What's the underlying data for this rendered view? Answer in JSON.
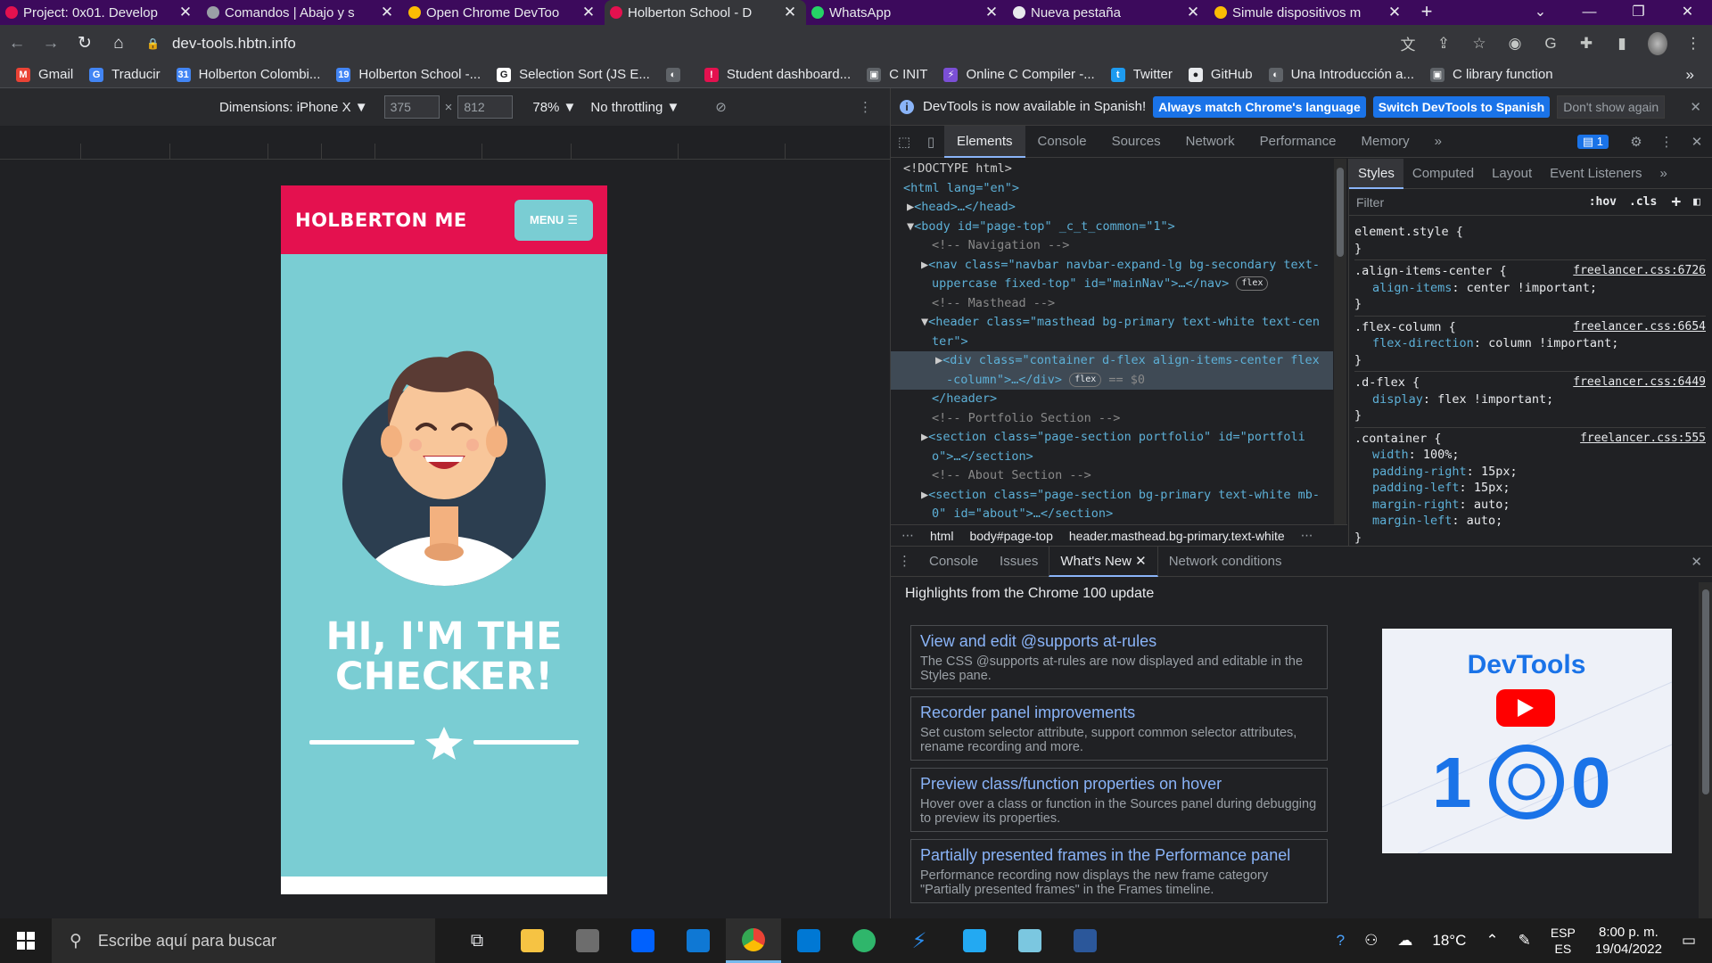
{
  "browser": {
    "tabs": [
      {
        "title": "Project: 0x01. Develop",
        "color": "#e4114f",
        "active": false
      },
      {
        "title": "Comandos | Abajo y s",
        "color": "#9aa0a6",
        "active": false
      },
      {
        "title": "Open Chrome DevToo",
        "color": "#fbbc04",
        "active": false
      },
      {
        "title": "Holberton School - D",
        "color": "#e4114f",
        "active": true
      },
      {
        "title": "WhatsApp",
        "color": "#25d366",
        "active": false
      },
      {
        "title": "Nueva pestaña",
        "color": "#e8eaed",
        "active": false
      },
      {
        "title": "Simule dispositivos m",
        "color": "#fbbc04",
        "active": false
      }
    ],
    "url": "dev-tools.hbtn.info",
    "bookmarks": [
      {
        "label": "Gmail",
        "color": "#ea4335",
        "glyph": "M"
      },
      {
        "label": "Traducir",
        "color": "#4285f4",
        "glyph": "G"
      },
      {
        "label": "Holberton Colombi...",
        "color": "#4285f4",
        "glyph": "31"
      },
      {
        "label": "Holberton School -...",
        "color": "#4285f4",
        "glyph": "19"
      },
      {
        "label": "Selection Sort (JS E...",
        "color": "#ffffff",
        "glyph": "G"
      },
      {
        "label": "",
        "color": "#5f6368",
        "glyph": "◐"
      },
      {
        "label": "Student dashboard...",
        "color": "#e4114f",
        "glyph": "!"
      },
      {
        "label": "C INIT",
        "color": "#5f6368",
        "glyph": "▣"
      },
      {
        "label": "Online C Compiler -...",
        "color": "#7b4fd6",
        "glyph": "⚡"
      },
      {
        "label": "Twitter",
        "color": "#1d9bf0",
        "glyph": "t"
      },
      {
        "label": "GitHub",
        "color": "#e8eaed",
        "glyph": "●"
      },
      {
        "label": "Una Introducción a...",
        "color": "#5f6368",
        "glyph": "◐"
      },
      {
        "label": "C library function",
        "color": "#5f6368",
        "glyph": "▣"
      }
    ],
    "bookmarks_more": "»"
  },
  "device_toolbar": {
    "dimensions": "Dimensions: iPhone X",
    "width": "375",
    "height": "812",
    "times": "×",
    "zoom": "78%",
    "throttling": "No throttling"
  },
  "page": {
    "brand": "HOLBERTON ME",
    "menu": "MENU",
    "headline_1": "HI, I'M THE",
    "headline_2": "CHECKER!",
    "nav_color": "#e4114f",
    "bg_color": "#7acdd3"
  },
  "devtools": {
    "info": {
      "message": "DevTools is now available in Spanish!",
      "btn_match": "Always match Chrome's language",
      "btn_switch": "Switch DevTools to Spanish",
      "btn_dismiss": "Don't show again"
    },
    "tabs": [
      "Elements",
      "Console",
      "Sources",
      "Network",
      "Performance",
      "Memory"
    ],
    "more": "»",
    "issue_badge": "1",
    "elements": {
      "doctype": "<!DOCTYPE html>",
      "html_open": "<html lang=\"en\">",
      "head": "<head>…</head>",
      "body": "<body id=\"page-top\" _c_t_common=\"1\">",
      "c_navigation": "<!-- Navigation -->",
      "nav_1": "<nav class=\"navbar navbar-expand-lg bg-secondary text-",
      "nav_2": "uppercase fixed-top\" id=\"mainNav\">…</nav>",
      "c_masthead": "<!-- Masthead -->",
      "header_1": "<header class=\"masthead bg-primary text-white text-cen",
      "header_2": "ter\">",
      "div_1": "<div class=\"container d-flex align-items-center flex",
      "div_2": "-column\">…</div>",
      "eq_sel": "== $0",
      "header_close": "</header>",
      "c_portfolio": "<!-- Portfolio Section -->",
      "section_1": "<section class=\"page-section portfolio\" id=\"portfoli",
      "section_2": "o\">…</section>",
      "c_about": "<!-- About Section -->",
      "section_3": "<section class=\"page-section bg-primary text-white mb-",
      "section_4": "0\" id=\"about\">…</section>",
      "flex_badge": "flex"
    },
    "breadcrumb": [
      "html",
      "body#page-top",
      "header.masthead.bg-primary.text-white"
    ],
    "styles": {
      "tabs": [
        "Styles",
        "Computed",
        "Layout",
        "Event Listeners"
      ],
      "more": "»",
      "filter_placeholder": "Filter",
      "hov": ":hov",
      "cls": ".cls",
      "rules": [
        {
          "selector": "element.style {",
          "source": "",
          "props": []
        },
        {
          "selector": ".align-items-center {",
          "source": "freelancer.css:6726",
          "props": [
            [
              "align-items",
              "center !important;"
            ]
          ]
        },
        {
          "selector": ".flex-column {",
          "source": "freelancer.css:6654",
          "props": [
            [
              "flex-direction",
              "column !important;"
            ]
          ]
        },
        {
          "selector": ".d-flex {",
          "source": "freelancer.css:6449",
          "props": [
            [
              "display",
              "flex !important;"
            ]
          ]
        },
        {
          "selector": ".container {",
          "source": "freelancer.css:555",
          "props": [
            [
              "width",
              "100%;"
            ],
            [
              "padding-right",
              "15px;"
            ],
            [
              "padding-left",
              "15px;"
            ],
            [
              "margin-right",
              "auto;"
            ],
            [
              "margin-left",
              "auto;"
            ]
          ]
        }
      ]
    },
    "drawer": {
      "tabs": [
        "Console",
        "Issues",
        "What's New",
        "Network conditions"
      ],
      "highlight": "Highlights from the Chrome 100 update",
      "cards": [
        {
          "title": "View and edit @supports at-rules",
          "desc": "The CSS @supports at-rules are now displayed and editable in the Styles pane."
        },
        {
          "title": "Recorder panel improvements",
          "desc": "Set custom selector attribute, support common selector attributes, rename recording and more."
        },
        {
          "title": "Preview class/function properties on hover",
          "desc": "Hover over a class or function in the Sources panel during debugging to preview its properties."
        },
        {
          "title": "Partially presented frames in the Performance panel",
          "desc": "Performance recording now displays the new frame category \"Partially presented frames\" in the Frames timeline."
        }
      ],
      "thumb_title": "DevTools",
      "thumb_num_a": "1",
      "thumb_num_b": "0"
    }
  },
  "taskbar": {
    "search_placeholder": "Escribe aquí para buscar",
    "temperature": "18°C",
    "lang_1": "ESP",
    "lang_2": "ES",
    "time": "8:00 p. m.",
    "date": "19/04/2022"
  }
}
